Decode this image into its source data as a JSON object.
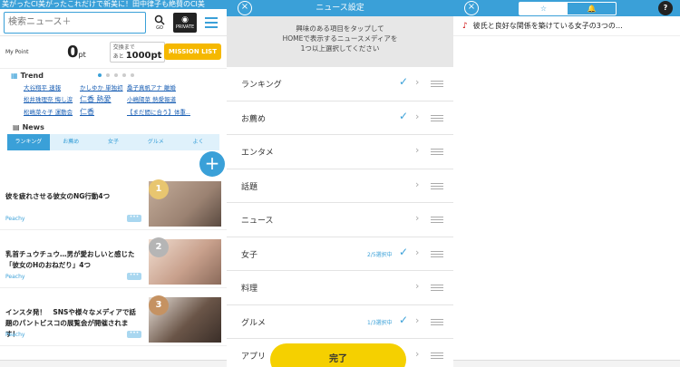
{
  "panel1": {
    "ticker": "美がったCI美がったこれだけで新美に！田中律子も絶賛のCI美",
    "search_placeholder": "検索ニュース＋",
    "go_label": "GO",
    "private_label": "PRIVATE",
    "my_point_label": "My Point",
    "points_value": "0",
    "points_unit": "pt",
    "bonus_line1": "交換まで",
    "bonus_line2": "あと",
    "bonus_value": "1000pt",
    "mission_label": "MISSION LIST",
    "trend_label": "Trend",
    "trend_items": [
      "大谷翔平 速報",
      "かしゆか 単独初",
      "桑子真帆アナ 離婚",
      "松井珠理奈 悔し涙",
      "仁香 熱愛",
      "小嶋陽菜 熱愛報道",
      "松嶋菜々子 運動会",
      "仁香",
      "【まだ間に合う】体重...｜広告"
    ],
    "news_label": "News",
    "tabs": [
      "ランキング",
      "お薦め",
      "女子",
      "グルメ",
      "よく"
    ],
    "fab_label": "+",
    "articles": [
      {
        "title": "彼を疲れさせる彼女のNG行動4つ",
        "source": "Peachy",
        "rank": "1",
        "color": "#9b8272"
      },
      {
        "title": "乳首チュウチュウ…男が愛おしいと感じた「彼女のHのおねだり」4つ",
        "source": "Peachy",
        "rank": "2",
        "color": "#c8a08c"
      },
      {
        "title": "インスタ発！　SNSや様々なメディアで話題のパントビスコの展覧会が開催されます！",
        "source": "Peachy",
        "rank": "3",
        "color": "#6a5548"
      }
    ],
    "more_label": "•••"
  },
  "panel2": {
    "title": "ニュース設定",
    "instruction": [
      "興味のある項目をタップして",
      "HOMEで表示するニュースメディアを",
      "1つ以上選択してください"
    ],
    "items": [
      {
        "label": "ランキング",
        "count": "",
        "checked": "✓"
      },
      {
        "label": "お薦め",
        "count": "",
        "checked": "✓"
      },
      {
        "label": "エンタメ",
        "count": "",
        "checked": ""
      },
      {
        "label": "話題",
        "count": "",
        "checked": ""
      },
      {
        "label": "ニュース",
        "count": "",
        "checked": ""
      },
      {
        "label": "女子",
        "count": "2/5選択中",
        "checked": "✓"
      },
      {
        "label": "料理",
        "count": "",
        "checked": ""
      },
      {
        "label": "グルメ",
        "count": "1/3選択中",
        "checked": "✓"
      },
      {
        "label": "アプリ",
        "count": "",
        "checked": ""
      }
    ],
    "done_label": "完了"
  },
  "panel3": {
    "star_label": "☆",
    "bell_label": "🔔",
    "help_label": "?",
    "saved_item": "彼氏と良好な関係を築けている女子の3つの…"
  },
  "colors": {
    "accent": "#3aa0d8",
    "yellow": "#f5d000",
    "mission": "#f5b800"
  }
}
